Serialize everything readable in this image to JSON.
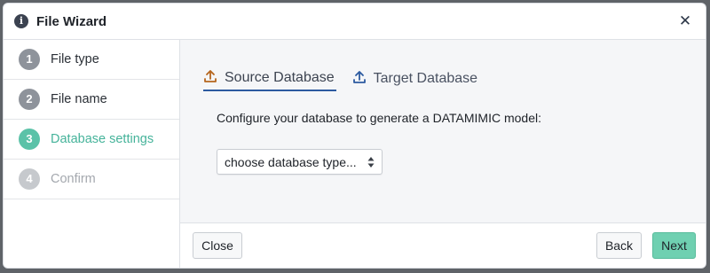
{
  "dialog": {
    "title": "File Wizard",
    "title_icon": "info-icon",
    "close_icon": "close-icon",
    "close_glyph": "✕"
  },
  "steps": [
    {
      "number": "1",
      "label": "File type",
      "state": "done"
    },
    {
      "number": "2",
      "label": "File name",
      "state": "done"
    },
    {
      "number": "3",
      "label": "Database settings",
      "state": "active"
    },
    {
      "number": "4",
      "label": "Confirm",
      "state": "pending"
    }
  ],
  "tabs": [
    {
      "label": "Source Database",
      "icon": "upload-icon",
      "active": true,
      "icon_color": "#b5651d"
    },
    {
      "label": "Target Database",
      "icon": "upload-icon",
      "active": false,
      "icon_color": "#2c5aa0"
    }
  ],
  "content": {
    "prompt": "Configure your database to generate a DATAMIMIC model:",
    "db_select": {
      "value": "choose database type...",
      "icon": "sort-caret-icon"
    }
  },
  "footer": {
    "close_label": "Close",
    "back_label": "Back",
    "next_label": "Next"
  },
  "colors": {
    "accent": "#5bc2a8",
    "next_button": "#6fd0b1",
    "tab_underline": "#2c5aa0"
  }
}
